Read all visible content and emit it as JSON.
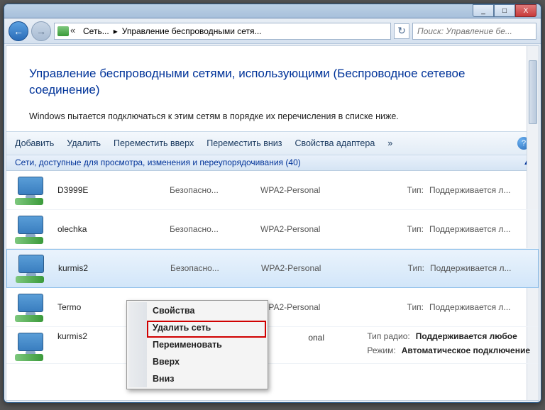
{
  "titlebar": {
    "min_label": "_",
    "max_label": "□",
    "close_label": "X"
  },
  "nav": {
    "breadcrumb_part1": "Сеть...",
    "breadcrumb_part2": "Управление беспроводными сетя...",
    "search_placeholder": "Поиск: Управление бе..."
  },
  "header": {
    "title": "Управление беспроводными сетями, использующими (Беспроводное сетевое соединение)",
    "subtitle": "Windows пытается подключаться к этим сетям в порядке их перечисления в списке ниже."
  },
  "toolbar": {
    "add": "Добавить",
    "remove": "Удалить",
    "move_up": "Переместить вверх",
    "move_down": "Переместить вниз",
    "adapter_props": "Свойства адаптера",
    "more": "»"
  },
  "list": {
    "header": "Сети, доступные для просмотра, изменения и переупорядочивания (40)",
    "type_label": "Тип:",
    "security_label": "Безопасно...",
    "radio_type_label": "Тип радио:",
    "mode_label": "Режим:",
    "networks": [
      {
        "name": "D3999E",
        "enc": "WPA2-Personal",
        "typeval": "Поддерживается л..."
      },
      {
        "name": "olechka",
        "enc": "WPA2-Personal",
        "typeval": "Поддерживается л..."
      },
      {
        "name": "kurmis2",
        "enc": "WPA2-Personal",
        "typeval": "Поддерживается л..."
      },
      {
        "name": "Termo",
        "enc": "WPA2-Personal",
        "typeval": "Поддерживается л..."
      },
      {
        "name": "kurmis2",
        "enc": "onal",
        "radio_type": "Поддерживается любое",
        "mode": "Автоматическое подключение"
      }
    ]
  },
  "context_menu": {
    "properties": "Свойства",
    "delete_network": "Удалить сеть",
    "rename": "Переименовать",
    "up": "Вверх",
    "down": "Вниз"
  }
}
